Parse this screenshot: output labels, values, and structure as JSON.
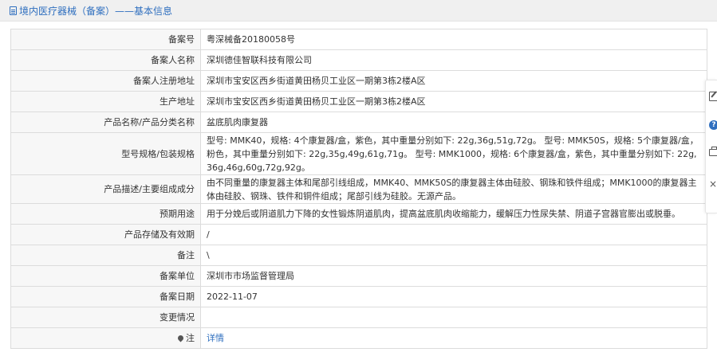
{
  "header": {
    "title": "境内医疗器械（备案）——基本信息"
  },
  "rows": [
    {
      "label": "备案号",
      "value": "粤深械备20180058号"
    },
    {
      "label": "备案人名称",
      "value": "深圳德佳智联科技有限公司"
    },
    {
      "label": "备案人注册地址",
      "value": "深圳市宝安区西乡街道黄田杨贝工业区一期第3栋2楼A区"
    },
    {
      "label": "生产地址",
      "value": "深圳市宝安区西乡街道黄田杨贝工业区一期第3栋2楼A区"
    },
    {
      "label": "产品名称/产品分类名称",
      "value": "盆底肌肉康复器"
    },
    {
      "label": "型号规格/包装规格",
      "value": "型号: MMK40，规格: 4个康复器/盒，紫色，其中重量分别如下: 22g,36g,51g,72g。 型号: MMK50S，规格: 5个康复器/盒，粉色，其中重量分别如下: 22g,35g,49g,61g,71g。 型号: MMK1000，规格: 6个康复器/盒，紫色，其中重量分别如下: 22g,36g,46g,60g,72g,92g。"
    },
    {
      "label": "产品描述/主要组成成分",
      "value": "由不同重量的康复器主体和尾部引线组成，MMK40、MMK50S的康复器主体由硅胶、钢珠和铁件组成；MMK1000的康复器主体由硅胶、钢珠、铁件和铜件组成；尾部引线为硅胶。无源产品。"
    },
    {
      "label": "预期用途",
      "value": "用于分娩后或阴道肌力下降的女性锻炼阴道肌肉，提高盆底肌肉收缩能力，缓解压力性尿失禁、阴道子宫器官膨出或脱垂。"
    },
    {
      "label": "产品存储及有效期",
      "value": "/"
    },
    {
      "label": "备注",
      "value": "\\"
    },
    {
      "label": "备案单位",
      "value": "深圳市市场监督管理局"
    },
    {
      "label": "备案日期",
      "value": "2022-11-07"
    },
    {
      "label": "变更情况",
      "value": ""
    }
  ],
  "note": {
    "label": "注",
    "link": "详情"
  },
  "side_tools": {
    "help_glyph": "?",
    "close_glyph": "×"
  }
}
